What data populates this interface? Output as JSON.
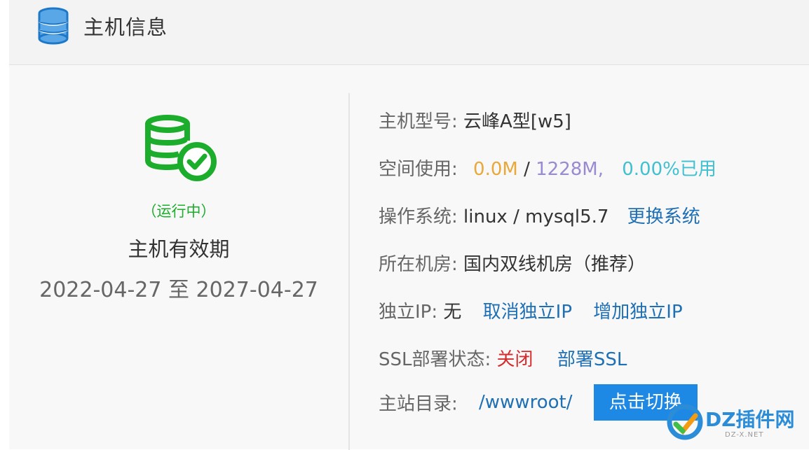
{
  "header": {
    "title": "主机信息",
    "icon": "database-icon"
  },
  "status": {
    "text": "（运行中）",
    "icon": "database-check-icon",
    "valid_label": "主机有效期",
    "valid_range": "2022-04-27 至 2027-04-27"
  },
  "info": {
    "model_label": "主机型号:",
    "model_value": "云峰A型[w5]",
    "space_label": "空间使用:",
    "space_used": "0.0M",
    "space_sep": " / ",
    "space_total": "1228M,",
    "space_percent": "0.00%已用",
    "os_label": "操作系统:",
    "os_value": "linux / mysql5.7",
    "os_link": "更换系统",
    "room_label": "所在机房:",
    "room_value": "国内双线机房（推荐）",
    "ip_label": "独立IP:",
    "ip_value": "无",
    "ip_cancel": "取消独立IP",
    "ip_add": "增加独立IP",
    "ssl_label": "SSL部署状态:",
    "ssl_value": "关闭",
    "ssl_link": "部署SSL",
    "dir_label": "主站目录:",
    "dir_value": "/wwwroot/",
    "dir_button": "点击切换"
  },
  "watermark": {
    "text": "DZ插件网",
    "sub": "DZ-X.NET"
  },
  "colors": {
    "accent_blue": "#1e88e5",
    "link_blue": "#1f6fb5",
    "running_green": "#1bad2b",
    "amber": "#e8a83a",
    "purple": "#9a8ad0",
    "teal": "#40c0d0",
    "red": "#d62b2b"
  }
}
